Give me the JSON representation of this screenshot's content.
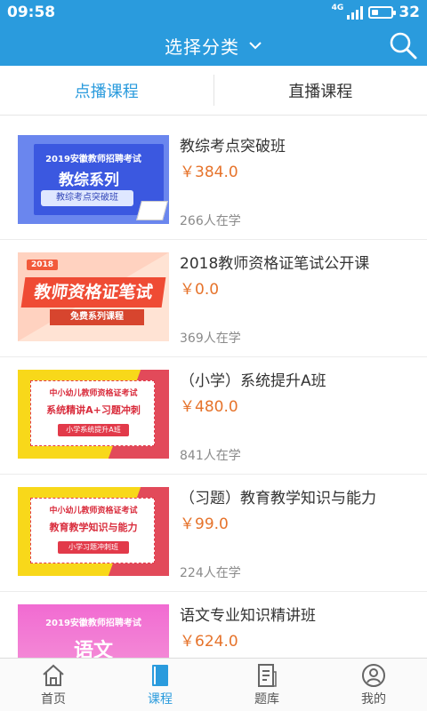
{
  "status_bar": {
    "time": "09:58",
    "network": "4G",
    "battery": "32",
    "battery_level": 0.32
  },
  "header": {
    "title": "选择分类",
    "dropdown_icon": "chevron-down-icon",
    "search_icon": "search-icon",
    "bg_color": "#2a9bdd"
  },
  "tabs": [
    {
      "label": "点播课程",
      "active": true
    },
    {
      "label": "直播课程",
      "active": false
    }
  ],
  "courses": [
    {
      "title": "教综考点突破班",
      "price": "￥384.0",
      "learners": "266人在学",
      "thumb": {
        "line1": "2019安徽教师招聘考试",
        "line2": "教综系列",
        "line3": "教综考点突破班"
      }
    },
    {
      "title": "2018教师资格证笔试公开课",
      "price": "￥0.0",
      "learners": "369人在学",
      "thumb": {
        "line1": "2018",
        "line2": "教师资格证笔试",
        "line3": "免费系列课程"
      }
    },
    {
      "title": "（小学）系统提升A班",
      "price": "￥480.0",
      "learners": "841人在学",
      "thumb": {
        "line1": "中小幼儿教师资格证考试",
        "line2": "系统精讲A+习题冲刺",
        "line3": "小学系统提升A班"
      }
    },
    {
      "title": "（习题）教育教学知识与能力",
      "price": "￥99.0",
      "learners": "224人在学",
      "thumb": {
        "line1": "中小幼儿教师资格证考试",
        "line2": "教育教学知识与能力",
        "line3": "小学习题冲刺班"
      }
    },
    {
      "title": "语文专业知识精讲班",
      "price": "￥624.0",
      "learners": "",
      "thumb": {
        "line1": "2019安徽教师招聘考试",
        "line2": "语文"
      }
    }
  ],
  "bottom_nav": [
    {
      "label": "首页",
      "icon": "home-icon",
      "active": false
    },
    {
      "label": "课程",
      "icon": "book-icon",
      "active": true
    },
    {
      "label": "题库",
      "icon": "document-icon",
      "active": false
    },
    {
      "label": "我的",
      "icon": "user-icon",
      "active": false
    }
  ],
  "colors": {
    "accent": "#2a9bdd",
    "price": "#e6732b"
  }
}
